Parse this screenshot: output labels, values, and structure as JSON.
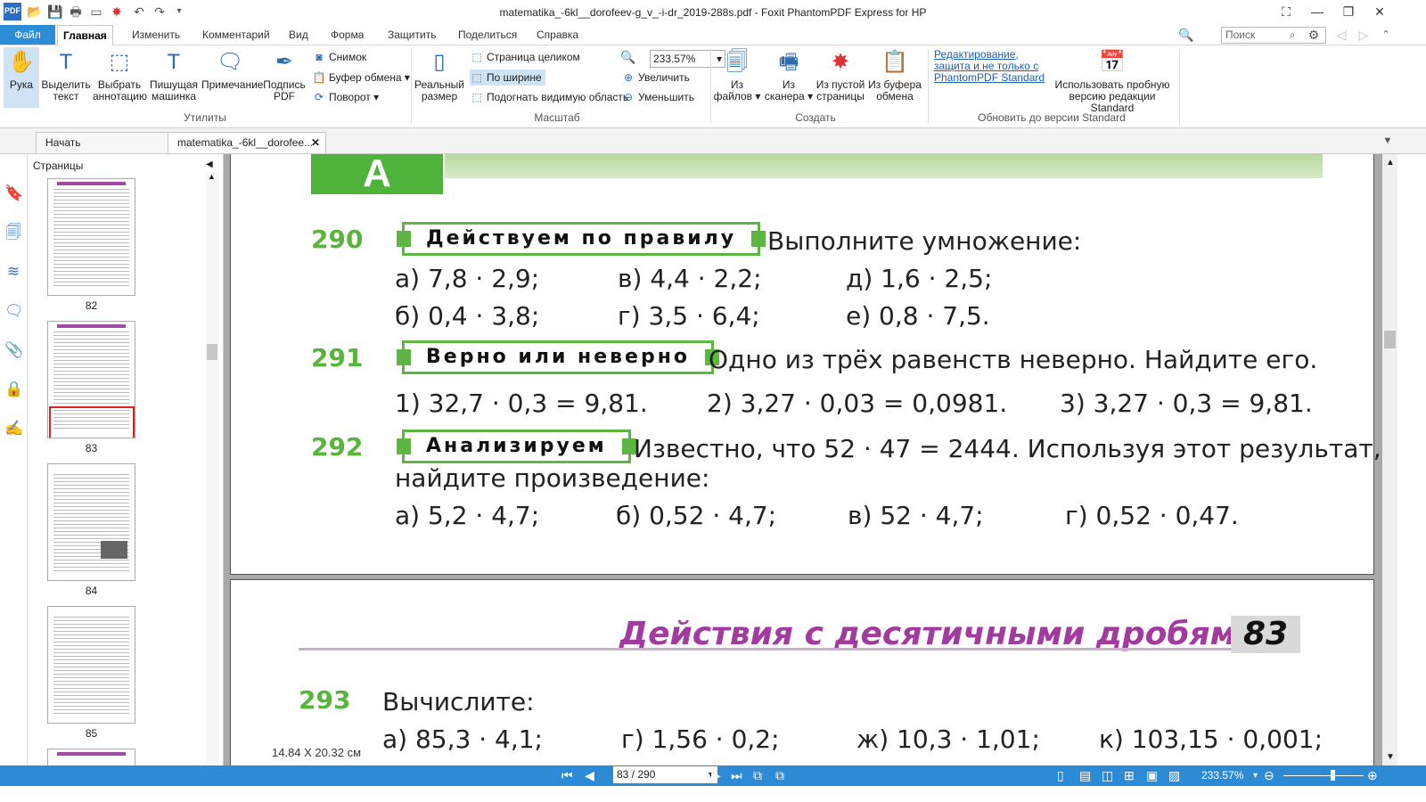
{
  "window": {
    "title": "matematika_-6kl__dorofeev-g_v_-i-dr_2019-288s.pdf - Foxit PhantomPDF Express for HP"
  },
  "menu": {
    "file": "Файл",
    "tabs": [
      "Главная",
      "Изменить",
      "Комментарий",
      "Вид",
      "Форма",
      "Защитить",
      "Поделиться",
      "Справка"
    ],
    "search_placeholder": "Поиск"
  },
  "ribbon": {
    "tools": [
      {
        "label": "Рука",
        "icon": "hand-icon"
      },
      {
        "label": "Выделить текст",
        "icon": "select-text-icon"
      },
      {
        "label": "Выбрать аннотацию",
        "icon": "select-annotation-icon"
      },
      {
        "label": "Пишущая машинка",
        "icon": "typewriter-icon"
      },
      {
        "label": "Примечание",
        "icon": "note-icon"
      },
      {
        "label": "Подпись PDF",
        "icon": "signature-icon"
      }
    ],
    "small_tools": [
      "Снимок",
      "Буфер обмена",
      "Поворот"
    ],
    "group_utilities": "Утилиты",
    "actual_size": "Реальный размер",
    "zoom_options": [
      "Страница целиком",
      "По ширине",
      "Подогнать видимую область"
    ],
    "zoom_value": "233.57%",
    "zoom_in": "Увеличить",
    "zoom_out": "Уменьшить",
    "group_zoom": "Масштаб",
    "create": [
      "Из файлов",
      "Из сканера",
      "Из пустой страницы",
      "Из буфера обмена"
    ],
    "group_create": "Создать",
    "upgrade_link": "Редактирование, защита и не только с PhantomPDF Standard",
    "upgrade_button": "Использовать пробную версию редакции Standard",
    "group_upgrade": "Обновить до версии Standard"
  },
  "doc_tabs": {
    "start": "Начать",
    "file": "matematika_-6kl__dorofee..."
  },
  "pages_panel": {
    "title": "Страницы",
    "thumbnails": [
      "82",
      "83",
      "84",
      "85"
    ]
  },
  "page_content": {
    "header_letter": "А",
    "problems": [
      {
        "num": "290",
        "badge": "Действуем по правилу",
        "task": "Выполните умножение:",
        "items": [
          "а) 7,8 · 2,9;",
          "в) 4,4 · 2,2;",
          "д) 1,6 · 2,5;",
          "б) 0,4 · 3,8;",
          "г) 3,5 · 6,4;",
          "е) 0,8 · 7,5."
        ]
      },
      {
        "num": "291",
        "badge": "Верно или неверно",
        "task": "Одно из трёх равенств неверно. Найдите его.",
        "items": [
          "1) 32,7 · 0,3 = 9,81.",
          "2) 3,27 · 0,03 = 0,0981.",
          "3) 3,27 · 0,3 = 9,81."
        ]
      },
      {
        "num": "292",
        "badge": "Анализируем",
        "task": "Известно, что 52 · 47 = 2444. Используя этот результат,",
        "task2": "найдите произведение:",
        "items": [
          "а) 5,2 · 4,7;",
          "б) 0,52 · 4,7;",
          "в) 52 · 4,7;",
          "г) 0,52 · 0,47."
        ]
      }
    ],
    "next_page": {
      "title": "Действия с десятичными дробями",
      "page_num": "83",
      "num": "293",
      "task": "Вычислите:",
      "items": [
        "а) 85,3 · 4,1;",
        "г) 1,56 · 0,2;",
        "ж) 10,3 · 1,01;",
        "к) 103,15 · 0,001;"
      ]
    }
  },
  "page_size": "14.84 X 20.32 см",
  "status": {
    "page": "83 / 290",
    "zoom": "233.57%"
  }
}
